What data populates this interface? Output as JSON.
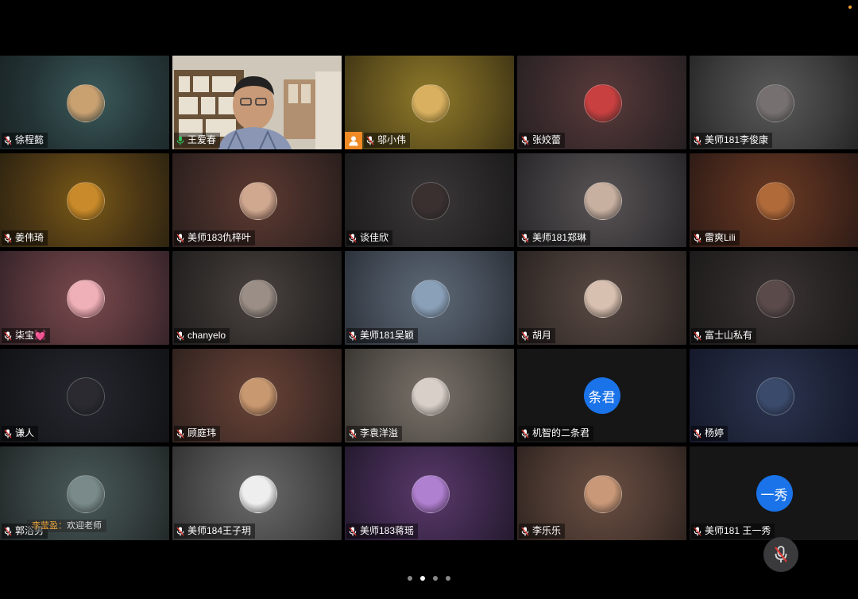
{
  "participants": [
    {
      "name": "徐程懿",
      "avatar": "child-photo",
      "color": "#c9a070",
      "muted": true,
      "active": false,
      "host": false
    },
    {
      "name": "王爱春",
      "avatar": "camera-video",
      "color": "#6b5a48",
      "muted": false,
      "active": true,
      "host": false
    },
    {
      "name": "邬小伟",
      "avatar": "wheat-photo",
      "color": "#d8b060",
      "muted": true,
      "active": false,
      "host": true
    },
    {
      "name": "张姣蕾",
      "avatar": "camera-toy-photo",
      "color": "#c84040",
      "muted": true,
      "active": false,
      "host": false
    },
    {
      "name": "美师181李俊康",
      "avatar": "person-photo",
      "color": "#777070",
      "muted": true,
      "active": false,
      "host": false
    },
    {
      "name": "姜伟琦",
      "avatar": "bear-photo",
      "color": "#c88a2a",
      "muted": true,
      "active": false,
      "host": false
    },
    {
      "name": "美师183仇梓叶",
      "avatar": "kid-photo",
      "color": "#d0a890",
      "muted": true,
      "active": false,
      "host": false
    },
    {
      "name": "谈佳欣",
      "avatar": "rose-photo",
      "color": "#3a3030",
      "muted": true,
      "active": false,
      "host": false
    },
    {
      "name": "美师181郑琳",
      "avatar": "girl-photo",
      "color": "#c8b0a0",
      "muted": true,
      "active": false,
      "host": false
    },
    {
      "name": "雷爽Lili",
      "avatar": "dog-photo",
      "color": "#b06a3a",
      "muted": true,
      "active": false,
      "host": false
    },
    {
      "name": "柒宝💓",
      "avatar": "pig-photo",
      "color": "#f0b0b8",
      "muted": true,
      "active": false,
      "host": false
    },
    {
      "name": "chanyelo",
      "avatar": "portrait-photo",
      "color": "#9a8e86",
      "muted": true,
      "active": false,
      "host": false
    },
    {
      "name": "美师181吴颖",
      "avatar": "sea-photo",
      "color": "#8aa0b8",
      "muted": true,
      "active": false,
      "host": false
    },
    {
      "name": "胡月",
      "avatar": "girl-photo",
      "color": "#d8c0b0",
      "muted": true,
      "active": false,
      "host": false
    },
    {
      "name": "富士山私有",
      "avatar": "girl-photo",
      "color": "#5a4a4a",
      "muted": true,
      "active": false,
      "host": false
    },
    {
      "name": "谦人",
      "avatar": "dark-photo",
      "color": "#2a2a30",
      "muted": true,
      "active": false,
      "host": false
    },
    {
      "name": "顾庭玮",
      "avatar": "dog-photo",
      "color": "#c89870",
      "muted": true,
      "active": false,
      "host": false
    },
    {
      "name": "李袁洋溢",
      "avatar": "person-photo",
      "color": "#d8d0c8",
      "muted": true,
      "active": false,
      "host": false
    },
    {
      "name": "机智的二条君",
      "avatar": "text",
      "avatar_text": "条君",
      "color": "#1a73e8",
      "muted": true,
      "active": false,
      "host": false
    },
    {
      "name": "杨婷",
      "avatar": "night-photo",
      "color": "#3a4a6a",
      "muted": true,
      "active": false,
      "host": false
    },
    {
      "name": "郭浴男",
      "avatar": "person-photo",
      "color": "#7a8a8a",
      "muted": true,
      "active": false,
      "host": false
    },
    {
      "name": "美师184王子玥",
      "avatar": "sketch-photo",
      "color": "#eeeeee",
      "muted": true,
      "active": false,
      "host": false
    },
    {
      "name": "美师183蒋瑶",
      "avatar": "cartoon-photo",
      "color": "#b080d0",
      "muted": true,
      "active": false,
      "host": false
    },
    {
      "name": "李乐乐",
      "avatar": "face-photo",
      "color": "#c89878",
      "muted": true,
      "active": false,
      "host": false
    },
    {
      "name": "美师181 王一秀",
      "avatar": "text",
      "avatar_text": "一秀",
      "color": "#1a73e8",
      "muted": true,
      "active": false,
      "host": false
    }
  ],
  "chat_toast": {
    "sender": "李莹盈：",
    "message": "欢迎老师"
  },
  "pager": {
    "pages": 4,
    "current": 2
  },
  "controls": {
    "mic_icon": "mic-muted-icon",
    "host_icon": "person-icon"
  },
  "colors": {
    "active_border": "#33c25a",
    "host_badge": "#f08a24",
    "text_avatar": "#1a73e8",
    "muted_mic": "#e53935"
  }
}
